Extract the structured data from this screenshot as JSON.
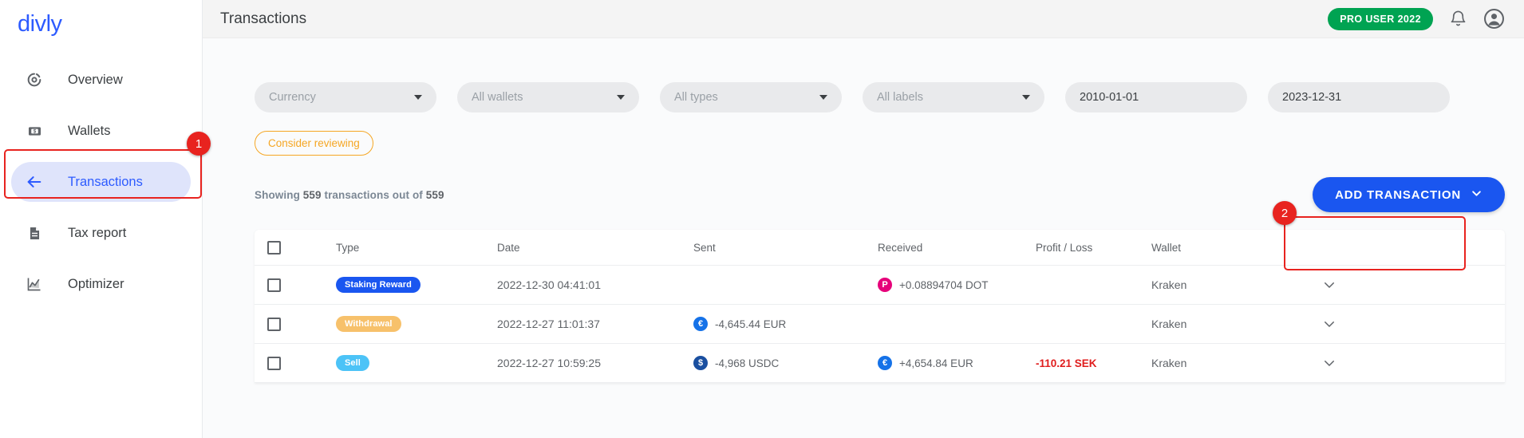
{
  "brand": "divly",
  "sidebar": {
    "items": [
      {
        "label": "Overview",
        "icon": "pie-chart-icon",
        "active": false
      },
      {
        "label": "Wallets",
        "icon": "wallet-icon",
        "active": false
      },
      {
        "label": "Transactions",
        "icon": "arrow-left-icon",
        "active": true
      },
      {
        "label": "Tax report",
        "icon": "document-icon",
        "active": false
      },
      {
        "label": "Optimizer",
        "icon": "line-chart-icon",
        "active": false
      }
    ]
  },
  "topbar": {
    "title": "Transactions",
    "pro_badge": "PRO USER 2022",
    "notification_icon": "bell-icon",
    "account_icon": "user-avatar-icon"
  },
  "filters": [
    {
      "name": "currency",
      "value": "Currency",
      "type": "select"
    },
    {
      "name": "wallets",
      "value": "All wallets",
      "type": "select"
    },
    {
      "name": "types",
      "value": "All types",
      "type": "select"
    },
    {
      "name": "labels",
      "value": "All labels",
      "type": "select"
    },
    {
      "name": "date-from",
      "value": "2010-01-01",
      "type": "date"
    },
    {
      "name": "date-to",
      "value": "2023-12-31",
      "type": "date"
    }
  ],
  "review_chip": "Consider reviewing",
  "showing": {
    "prefix": "Showing ",
    "count": "559",
    "middle": " transactions out of ",
    "total": "559"
  },
  "add_transaction": {
    "label": "ADD TRANSACTION",
    "chevron": "chevron-down-icon"
  },
  "table": {
    "columns": [
      "Type",
      "Date",
      "Sent",
      "Received",
      "Profit / Loss",
      "Wallet"
    ],
    "rows": [
      {
        "type": "Staking Reward",
        "type_style": "staking",
        "date": "2022-12-30 04:41:01",
        "sent": "",
        "sent_coin": "",
        "received": "+0.08894704 DOT",
        "received_coin": "dot",
        "received_coin_symbol": "P",
        "profit_loss": "",
        "wallet": "Kraken"
      },
      {
        "type": "Withdrawal",
        "type_style": "withdraw",
        "date": "2022-12-27 11:01:37",
        "sent": "-4,645.44 EUR",
        "sent_coin": "eur",
        "sent_coin_symbol": "€",
        "received": "",
        "received_coin": "",
        "profit_loss": "",
        "wallet": "Kraken"
      },
      {
        "type": "Sell",
        "type_style": "sell",
        "date": "2022-12-27 10:59:25",
        "sent": "-4,968 USDC",
        "sent_coin": "usdc",
        "sent_coin_symbol": "$",
        "received": "+4,654.84 EUR",
        "received_coin": "eur",
        "received_coin_symbol": "€",
        "profit_loss": "-110.21 SEK",
        "wallet": "Kraken"
      }
    ]
  },
  "annotations": [
    {
      "number": "1",
      "target": "sidebar-item-transactions"
    },
    {
      "number": "2",
      "target": "add-transaction-button"
    }
  ],
  "colors": {
    "brand": "#2d5bff",
    "accent_blue": "#1a56f0",
    "pro_green": "#00a352",
    "warning_orange": "#f5a623",
    "loss_red": "#e01e1e",
    "annotation_red": "#e8231f"
  }
}
